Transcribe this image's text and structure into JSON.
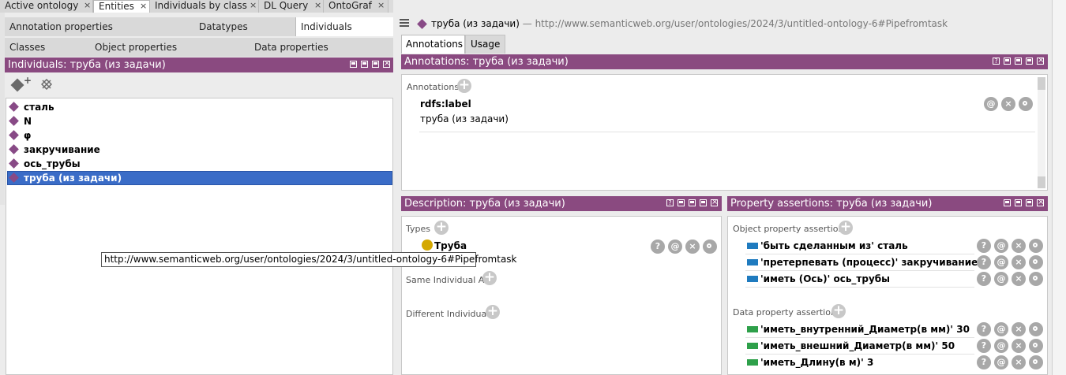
{
  "top_tabs": [
    {
      "label": "Active ontology"
    },
    {
      "label": "Entities"
    },
    {
      "label": "Individuals by class"
    },
    {
      "label": "DL Query"
    },
    {
      "label": "OntoGraf"
    }
  ],
  "sub_tabs_row1": [
    "Annotation properties",
    "Datatypes",
    "Individuals"
  ],
  "sub_tabs_row2": [
    "Classes",
    "Object properties",
    "Data properties"
  ],
  "left_panel": {
    "title": "Individuals: труба (из задачи)",
    "individuals": [
      "сталь",
      "N",
      "φ",
      "закручивание",
      "ось_трубы",
      "труба (из задачи)"
    ]
  },
  "entity_header": {
    "name": "труба (из задачи)",
    "separator": "—",
    "iri": "http://www.semanticweb.org/user/ontologies/2024/3/untitled-ontology-6#Pipefromtask"
  },
  "right_tabs": [
    "Annotations",
    "Usage"
  ],
  "annotations_panel": {
    "title": "Annotations: труба (из задачи)",
    "section": "Annotations",
    "property": "rdfs:label",
    "value": "труба (из задачи)",
    "buttons": [
      "@",
      "×",
      "o"
    ]
  },
  "description_panel": {
    "title": "Description: труба (из задачи)",
    "types_label": "Types",
    "type_value": "Труба",
    "same_label": "Same Individual As",
    "different_label": "Different Individuals"
  },
  "property_panel": {
    "title": "Property assertions: труба (из задачи)",
    "object_label": "Object property assertions",
    "object_assertions": [
      {
        "prop": "'быть сделанным из'",
        "value": "сталь"
      },
      {
        "prop": "'претерпевать (процесс)'",
        "value": "закручивание"
      },
      {
        "prop": "'иметь (Ось)'",
        "value": "ось_трубы"
      }
    ],
    "data_label": "Data property assertions",
    "data_assertions": [
      {
        "prop": "'иметь_внутренний_Диаметр(в мм)'",
        "value": "30"
      },
      {
        "prop": "'иметь_внешний_Диаметр(в мм)'",
        "value": "50"
      },
      {
        "prop": "'иметь_Длину(в м)'",
        "value": "3"
      }
    ]
  },
  "tooltip": "http://www.semanticweb.org/user/ontologies/2024/3/untitled-ontology-6#Pipefromtask",
  "colors": {
    "header_purple": "#8a4a80",
    "selection_blue": "#3a6cc7",
    "object_prop": "#1f7bbf",
    "data_prop": "#2ea04a",
    "class_yellow": "#d4a800"
  }
}
